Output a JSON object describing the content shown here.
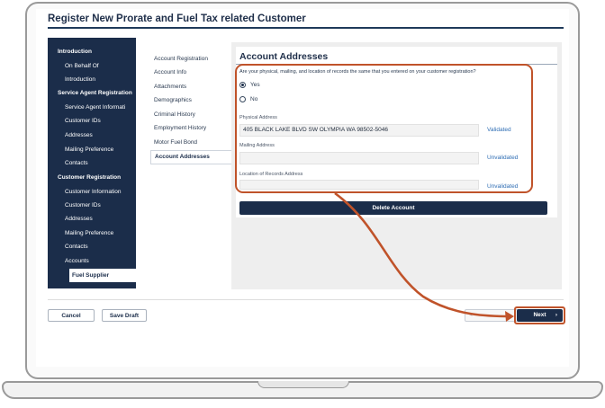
{
  "page": {
    "title": "Register New Prorate and Fuel Tax related Customer"
  },
  "sidebar": {
    "items": [
      {
        "label": "Introduction",
        "kind": "head"
      },
      {
        "label": "On Behalf Of",
        "kind": "sub"
      },
      {
        "label": "Introduction",
        "kind": "sub"
      },
      {
        "label": "Service Agent Registration",
        "kind": "head"
      },
      {
        "label": "Service Agent Informati",
        "kind": "sub"
      },
      {
        "label": "Customer IDs",
        "kind": "sub"
      },
      {
        "label": "Addresses",
        "kind": "sub"
      },
      {
        "label": "Mailing Preference",
        "kind": "sub"
      },
      {
        "label": "Contacts",
        "kind": "sub"
      },
      {
        "label": "Customer Registration",
        "kind": "head"
      },
      {
        "label": "Customer Information",
        "kind": "sub"
      },
      {
        "label": "Customer IDs",
        "kind": "sub"
      },
      {
        "label": "Addresses",
        "kind": "sub"
      },
      {
        "label": "Mailing Preference",
        "kind": "sub"
      },
      {
        "label": "Contacts",
        "kind": "sub"
      },
      {
        "label": "Accounts",
        "kind": "sub"
      },
      {
        "label": "Fuel Supplier",
        "kind": "active"
      }
    ]
  },
  "subnav": {
    "items": [
      "Account Registration",
      "Account Info",
      "Attachments",
      "Demographics",
      "Criminal History",
      "Employment History",
      "Motor Fuel Bond",
      "Account Addresses"
    ],
    "active_index": 7
  },
  "main": {
    "heading": "Account Addresses",
    "question": "Are your physical, mailing, and location of records the same that you entered on your customer registration?",
    "options": [
      {
        "label": "Yes",
        "selected": true
      },
      {
        "label": "No",
        "selected": false
      }
    ],
    "fields": [
      {
        "label": "Physical Address",
        "value": "405 BLACK LAKE BLVD SW OLYMPIA WA 98502-5046",
        "status": "Validated"
      },
      {
        "label": "Mailing Address",
        "value": "",
        "status": "Unvalidated"
      },
      {
        "label": "Location of Records Address",
        "value": "",
        "status": "Unvalidated"
      }
    ],
    "delete_label": "Delete Account"
  },
  "footer": {
    "cancel_label": "Cancel",
    "save_draft_label": "Save Draft",
    "previous_label": "<",
    "next_label": "Next",
    "next_chevron": "›"
  },
  "colors": {
    "navy": "#1b2d4a",
    "highlight": "#c0532a",
    "link": "#2e6db4"
  }
}
